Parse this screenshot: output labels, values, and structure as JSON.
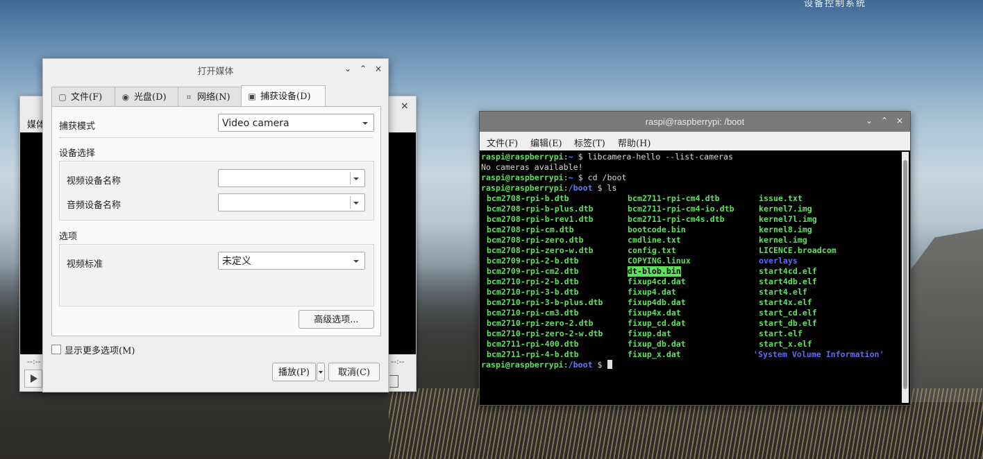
{
  "desktop": {
    "top_text": "设备控制系统"
  },
  "back_window": {
    "label": "媒体",
    "close": "×",
    "time_left": "--:--",
    "time_right": "--:--"
  },
  "dialog": {
    "title": "打开媒体",
    "controls": {
      "min": "⌄",
      "max": "⌃",
      "close": "×"
    },
    "tabs": [
      {
        "label": "文件(F)",
        "icon": "file-icon"
      },
      {
        "label": "光盘(D)",
        "icon": "disc-icon"
      },
      {
        "label": "网络(N)",
        "icon": "network-icon"
      },
      {
        "label": "捕获设备(D)",
        "icon": "capture-device-icon",
        "active": true
      }
    ],
    "capture_mode_label": "捕获模式",
    "capture_mode_value": "Video camera",
    "device_section": "设备选择",
    "video_device_label": "视频设备名称",
    "audio_device_label": "音频设备名称",
    "options_section": "选项",
    "video_standard_label": "视频标准",
    "video_standard_value": "未定义",
    "advanced_button": "高级选项...",
    "show_more": "显示更多选项(M)",
    "play_button": "播放(P)",
    "cancel_button": "取消(C)"
  },
  "terminal": {
    "title": "raspi@raspberrypi: /boot",
    "controls": {
      "min": "⌄",
      "max": "⌃",
      "close": "×"
    },
    "menu": [
      "文件(F)",
      "编辑(E)",
      "标签(T)",
      "帮助(H)"
    ],
    "prompt_user": "raspi@raspberrypi",
    "lines": [
      {
        "kind": "prompt",
        "path": "~",
        "cmd": "libcamera-hello --list-cameras"
      },
      {
        "kind": "out",
        "text": "No cameras available!"
      },
      {
        "kind": "prompt",
        "path": "~",
        "cmd": "cd /boot"
      },
      {
        "kind": "prompt",
        "path": "/boot",
        "cmd": "ls"
      }
    ],
    "ls_rows": [
      [
        [
          "bcm2708-rpi-b.dtb",
          "g"
        ],
        [
          "bcm2711-rpi-cm4.dtb",
          "g"
        ],
        [
          "issue.txt",
          "g"
        ]
      ],
      [
        [
          "bcm2708-rpi-b-plus.dtb",
          "g"
        ],
        [
          "bcm2711-rpi-cm4-io.dtb",
          "g"
        ],
        [
          "kernel7.img",
          "g"
        ]
      ],
      [
        [
          "bcm2708-rpi-b-rev1.dtb",
          "g"
        ],
        [
          "bcm2711-rpi-cm4s.dtb",
          "g"
        ],
        [
          "kernel7l.img",
          "g"
        ]
      ],
      [
        [
          "bcm2708-rpi-cm.dtb",
          "g"
        ],
        [
          "bootcode.bin",
          "g"
        ],
        [
          "kernel8.img",
          "g"
        ]
      ],
      [
        [
          "bcm2708-rpi-zero.dtb",
          "g"
        ],
        [
          "cmdline.txt",
          "g"
        ],
        [
          "kernel.img",
          "g"
        ]
      ],
      [
        [
          "bcm2708-rpi-zero-w.dtb",
          "g"
        ],
        [
          "config.txt",
          "g"
        ],
        [
          "LICENCE.broadcom",
          "g"
        ]
      ],
      [
        [
          "bcm2709-rpi-2-b.dtb",
          "g"
        ],
        [
          "COPYING.linux",
          "g"
        ],
        [
          "overlays",
          "b"
        ]
      ],
      [
        [
          "bcm2709-rpi-cm2.dtb",
          "g"
        ],
        [
          "dt-blob.bin",
          "hl"
        ],
        [
          "start4cd.elf",
          "g"
        ]
      ],
      [
        [
          "bcm2710-rpi-2-b.dtb",
          "g"
        ],
        [
          "fixup4cd.dat",
          "g"
        ],
        [
          "start4db.elf",
          "g"
        ]
      ],
      [
        [
          "bcm2710-rpi-3-b.dtb",
          "g"
        ],
        [
          "fixup4.dat",
          "g"
        ],
        [
          "start4.elf",
          "g"
        ]
      ],
      [
        [
          "bcm2710-rpi-3-b-plus.dtb",
          "g"
        ],
        [
          "fixup4db.dat",
          "g"
        ],
        [
          "start4x.elf",
          "g"
        ]
      ],
      [
        [
          "bcm2710-rpi-cm3.dtb",
          "g"
        ],
        [
          "fixup4x.dat",
          "g"
        ],
        [
          "start_cd.elf",
          "g"
        ]
      ],
      [
        [
          "bcm2710-rpi-zero-2.dtb",
          "g"
        ],
        [
          "fixup_cd.dat",
          "g"
        ],
        [
          "start_db.elf",
          "g"
        ]
      ],
      [
        [
          "bcm2710-rpi-zero-2-w.dtb",
          "g"
        ],
        [
          "fixup.dat",
          "g"
        ],
        [
          "start.elf",
          "g"
        ]
      ],
      [
        [
          "bcm2711-rpi-400.dtb",
          "g"
        ],
        [
          "fixup_db.dat",
          "g"
        ],
        [
          "start_x.elf",
          "g"
        ]
      ],
      [
        [
          "bcm2711-rpi-4-b.dtb",
          "g"
        ],
        [
          "fixup_x.dat",
          "g"
        ],
        [
          "'System Volume Information'",
          "b"
        ]
      ]
    ],
    "final_prompt_path": "/boot"
  }
}
